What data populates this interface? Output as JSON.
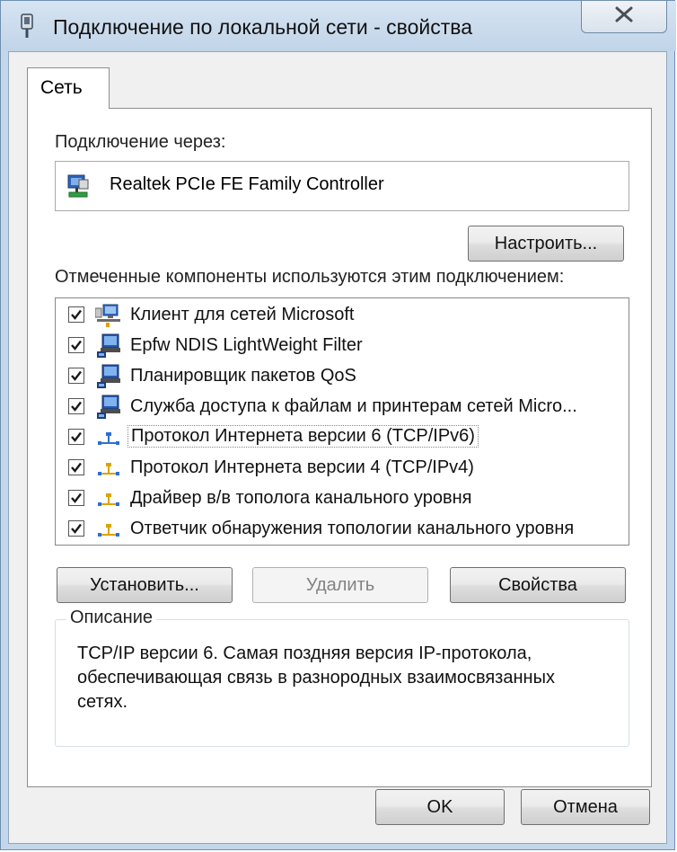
{
  "window": {
    "title": "Подключение по локальной сети - свойства"
  },
  "tab": {
    "label": "Сеть"
  },
  "connection": {
    "label": "Подключение через:",
    "adapter_name": "Realtek PCIe FE Family Controller",
    "configure_label": "Настроить..."
  },
  "components": {
    "label": "Отмеченные компоненты используются этим подключением:",
    "items": [
      {
        "label": "Клиент для сетей Microsoft",
        "checked": true,
        "icon": "network-client-icon"
      },
      {
        "label": "Epfw NDIS LightWeight Filter",
        "checked": true,
        "icon": "network-service-icon"
      },
      {
        "label": "Планировщик пакетов QoS",
        "checked": true,
        "icon": "network-service-icon"
      },
      {
        "label": "Служба доступа к файлам и принтерам сетей Micro...",
        "checked": true,
        "icon": "network-service-icon"
      },
      {
        "label": "Протокол Интернета версии 6 (TCP/IPv6)",
        "checked": true,
        "icon": "protocol-icon",
        "selected": true
      },
      {
        "label": "Протокол Интернета версии 4 (TCP/IPv4)",
        "checked": true,
        "icon": "protocol-icon"
      },
      {
        "label": "Драйвер в/в тополога канального уровня",
        "checked": true,
        "icon": "protocol-icon"
      },
      {
        "label": "Ответчик обнаружения топологии канального уровня",
        "checked": true,
        "icon": "protocol-icon"
      }
    ]
  },
  "buttons": {
    "install": "Установить...",
    "remove": "Удалить",
    "properties": "Свойства",
    "ok": "OK",
    "cancel": "Отмена"
  },
  "description": {
    "legend": "Описание",
    "text": "TCP/IP версии 6. Самая поздняя версия IP-протокола, обеспечивающая связь в разнородных взаимосвязанных сетях."
  },
  "colors": {
    "titlebar": "#c3d6ea",
    "dialog_background": "#f0f0f0",
    "panel_background": "#ffffff"
  }
}
